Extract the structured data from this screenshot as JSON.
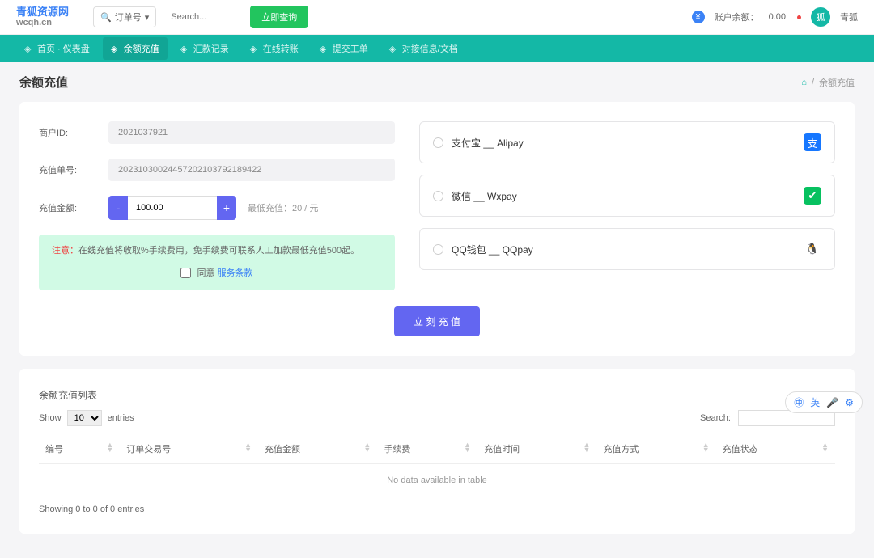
{
  "topbar": {
    "logo_cn": "青狐资源网",
    "logo_en": "wcqh.cn",
    "search_type": "订单号",
    "search_placeholder": "Search...",
    "search_btn": "立即查询",
    "balance_label": "账户余额：",
    "balance_value": "0.00",
    "username": "青狐"
  },
  "nav": [
    {
      "label": "首页 · 仪表盘"
    },
    {
      "label": "余额充值",
      "active": true
    },
    {
      "label": "汇款记录"
    },
    {
      "label": "在线转账"
    },
    {
      "label": "提交工单"
    },
    {
      "label": "对接信息/文档"
    }
  ],
  "page": {
    "title": "余额充值",
    "breadcrumb_current": "余额充值"
  },
  "form": {
    "merchant_label": "商户ID:",
    "merchant_value": "2021037921",
    "order_label": "充值单号:",
    "order_value": "20231030024457202103792189422",
    "amount_label": "充值金额:",
    "amount_value": "100.00",
    "min_text": "最低充值：20 / 元",
    "notice_prefix": "注意：",
    "notice_body": "在线充值将收取%手续费用，免手续费可联系人工加款最低充值500起。",
    "agree_text": "同意",
    "agree_link": "服务条款",
    "submit": "立 刻 充 值"
  },
  "pay": [
    {
      "label": "支付宝 __ Alipay",
      "icon": "支",
      "cls": "pay-alipay"
    },
    {
      "label": "微信 __ Wxpay",
      "icon": "✔",
      "cls": "pay-wx"
    },
    {
      "label": "QQ钱包 __ QQpay",
      "icon": "🐧",
      "cls": "pay-qq"
    }
  ],
  "list": {
    "title": "余额充值列表",
    "show": "Show",
    "entries": "entries",
    "page_size": "10",
    "search_label": "Search:",
    "cols": [
      "编号",
      "订单交易号",
      "充值金额",
      "手续费",
      "充值时间",
      "充值方式",
      "充值状态"
    ],
    "empty": "No data available in table",
    "footer": "Showing 0 to 0 of 0 entries"
  },
  "ime": {
    "items": [
      "㊥",
      "英",
      "🎤",
      "⚙"
    ]
  }
}
